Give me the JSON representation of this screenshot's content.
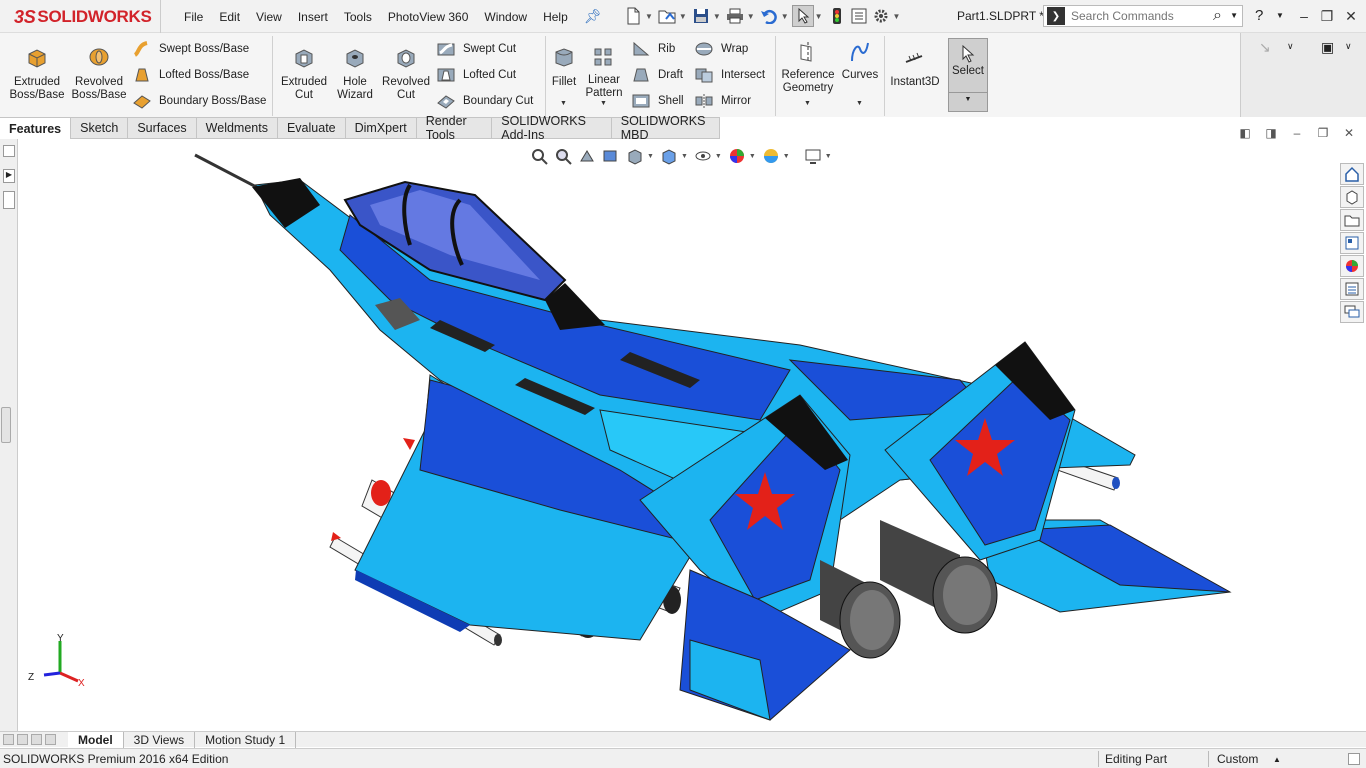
{
  "app": {
    "logo_text": "SOLIDWORKS",
    "logo_mark": "3S",
    "document_title": "Part1.SLDPRT *"
  },
  "menu": [
    "File",
    "Edit",
    "View",
    "Insert",
    "Tools",
    "PhotoView 360",
    "Window",
    "Help"
  ],
  "search": {
    "placeholder": "Search Commands"
  },
  "help_label": "?",
  "features_toolbar": {
    "extruded_boss": "Extruded Boss/Base",
    "revolved_boss": "Revolved Boss/Base",
    "swept_boss": "Swept Boss/Base",
    "lofted_boss": "Lofted Boss/Base",
    "boundary_boss": "Boundary Boss/Base",
    "extruded_cut": "Extruded Cut",
    "hole_wizard": "Hole Wizard",
    "revolved_cut": "Revolved Cut",
    "swept_cut": "Swept Cut",
    "lofted_cut": "Lofted Cut",
    "boundary_cut": "Boundary Cut",
    "fillet": "Fillet",
    "linear_pattern": "Linear Pattern",
    "rib": "Rib",
    "draft": "Draft",
    "shell": "Shell",
    "wrap": "Wrap",
    "intersect": "Intersect",
    "mirror": "Mirror",
    "reference_geometry": "Reference Geometry",
    "curves": "Curves",
    "instant3d": "Instant3D",
    "select": "Select"
  },
  "tabs": [
    "Features",
    "Sketch",
    "Surfaces",
    "Weldments",
    "Evaluate",
    "DimXpert",
    "Render Tools",
    "SOLIDWORKS Add-Ins",
    "SOLIDWORKS MBD"
  ],
  "active_tab": "Features",
  "triad": {
    "x": "X",
    "y": "Y",
    "z": "Z"
  },
  "bottom_tabs": [
    "Model",
    "3D Views",
    "Motion Study 1"
  ],
  "active_bottom_tab": "Model",
  "status": {
    "edition": "SOLIDWORKS Premium 2016 x64 Edition",
    "mode": "Editing Part",
    "units": "Custom"
  },
  "colors": {
    "brand_red": "#d2232a",
    "jet_dark_blue": "#1a4fd8",
    "jet_light_blue": "#1cb4f0",
    "star_red": "#e32119"
  }
}
